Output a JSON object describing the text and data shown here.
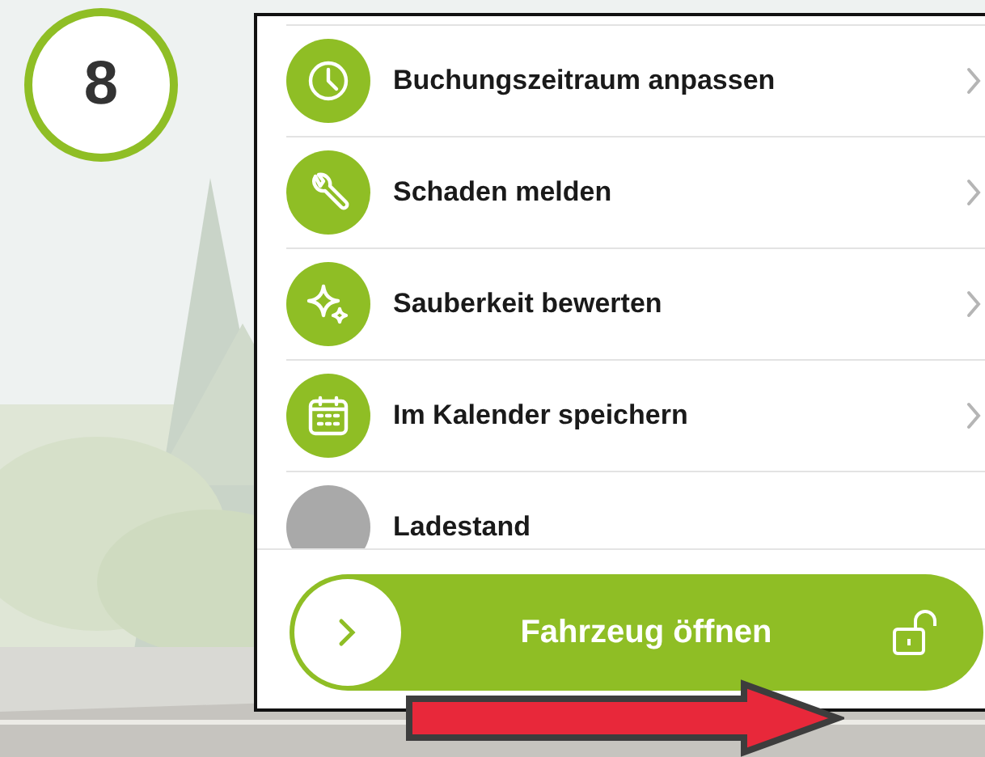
{
  "step_badge": "8",
  "menu_items": [
    {
      "label": "Buchungszeitraum anpassen",
      "kind": "clock"
    },
    {
      "label": "Schaden melden",
      "kind": "wrench"
    },
    {
      "label": "Sauberkeit bewerten",
      "kind": "sparkle"
    },
    {
      "label": "Im Kalender speichern",
      "kind": "calendar"
    },
    {
      "label": "Ladestand",
      "kind": "status"
    }
  ],
  "unlock_slider": {
    "label": "Fahrzeug öffnen",
    "level": 0
  }
}
